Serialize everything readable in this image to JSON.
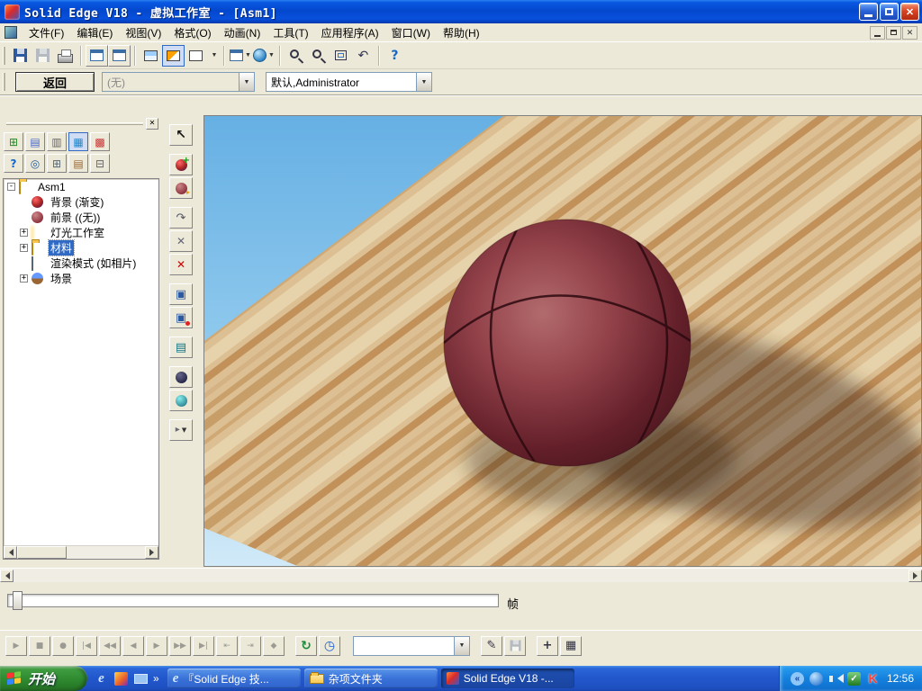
{
  "colors": {
    "titlebar": "#0A53D6",
    "selection": "#316AC5",
    "face": "#ECE9D8",
    "taskbar": "#2258CD",
    "start_green": "#2F8A2F",
    "sky": "#7AB8E8",
    "wood": "#D9BB8C",
    "ball": "#7E2F35"
  },
  "titlebar": {
    "title": "Solid Edge V18 - 虚拟工作室 - [Asm1]"
  },
  "menu": {
    "items": [
      "文件(F)",
      "编辑(E)",
      "视图(V)",
      "格式(O)",
      "动画(N)",
      "工具(T)",
      "应用程序(A)",
      "窗口(W)",
      "帮助(H)"
    ]
  },
  "toolbar": {
    "back": "返回",
    "combo_preset": "(无)",
    "combo_config": "默认,Administrator"
  },
  "tree": {
    "root": "Asm1",
    "items": [
      {
        "label": "背景 (渐变)"
      },
      {
        "label": "前景 ((无))"
      },
      {
        "label": "灯光工作室"
      },
      {
        "label": "材料"
      },
      {
        "label": "渲染模式 (如相片)"
      },
      {
        "label": "场景"
      }
    ]
  },
  "timeline": {
    "frame_label": "帧"
  },
  "playback": {
    "transport": [
      "▶",
      "■",
      "●",
      "|◀",
      "◀◀",
      "◀",
      "▶",
      "▶▶",
      "▶|",
      "⇤",
      "⇥",
      "◆"
    ],
    "loop": "↻",
    "clock": "◷",
    "combo_value": ""
  },
  "panel_tools": [
    "⊞",
    "▤",
    "▥",
    "▦",
    "▩",
    "?",
    "◎",
    "⊞",
    "▤",
    "⊟"
  ],
  "glyphs": {
    "minus": "-",
    "plus": "+",
    "close": "✕",
    "dropdown": "▼",
    "help": "?",
    "prev_view": "↶",
    "curve": "↷",
    "x": "✕",
    "cube": "▣",
    "book": "▤",
    "play_small": "▸",
    "pencil": "✎",
    "render": "▦",
    "chevron": "»",
    "tray_chevron": "«",
    "check": "✓",
    "k": "K",
    "ie": "e"
  },
  "taskbar": {
    "start": "开始",
    "tasks": [
      {
        "label": "『Solid Edge 技..."
      },
      {
        "label": "杂项文件夹"
      },
      {
        "label": "Solid Edge V18 -..."
      }
    ],
    "time": "12:56"
  }
}
